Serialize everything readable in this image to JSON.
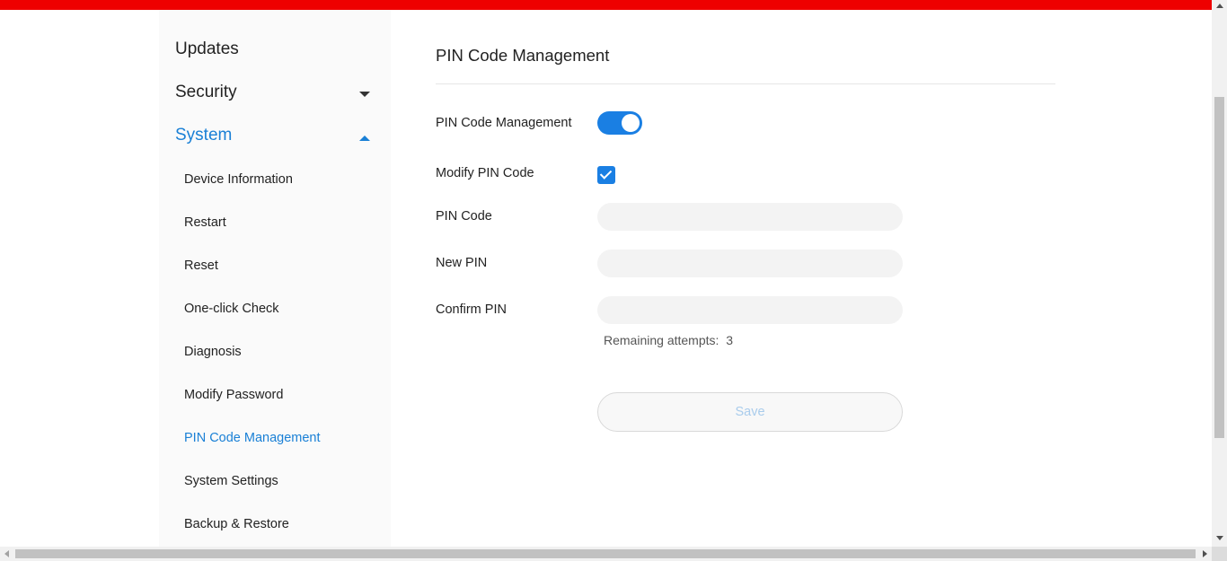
{
  "colors": {
    "brand_bar": "#ee0000",
    "accent": "#1a80d6"
  },
  "sidebar": {
    "groups": [
      {
        "label": "Updates"
      },
      {
        "label": "Security",
        "icon": "chevron-down-icon"
      },
      {
        "label": "System",
        "icon": "chevron-up-icon",
        "expanded": true
      }
    ],
    "system_items": [
      {
        "label": "Device Information"
      },
      {
        "label": "Restart"
      },
      {
        "label": "Reset"
      },
      {
        "label": "One-click Check"
      },
      {
        "label": "Diagnosis"
      },
      {
        "label": "Modify Password"
      },
      {
        "label": "PIN Code Management",
        "selected": true
      },
      {
        "label": "System Settings"
      },
      {
        "label": "Backup & Restore"
      }
    ]
  },
  "main": {
    "title": "PIN Code Management",
    "pin_management": {
      "label": "PIN Code Management",
      "enabled": true
    },
    "modify_pin": {
      "label": "Modify PIN Code",
      "checked": true
    },
    "pin_code": {
      "label": "PIN Code",
      "value": "",
      "placeholder": ""
    },
    "new_pin": {
      "label": "New PIN",
      "value": "",
      "placeholder": ""
    },
    "confirm_pin": {
      "label": "Confirm PIN",
      "value": "",
      "placeholder": ""
    },
    "remaining_attempts_label": "Remaining attempts:",
    "remaining_attempts_value": "3",
    "save_label": "Save"
  }
}
